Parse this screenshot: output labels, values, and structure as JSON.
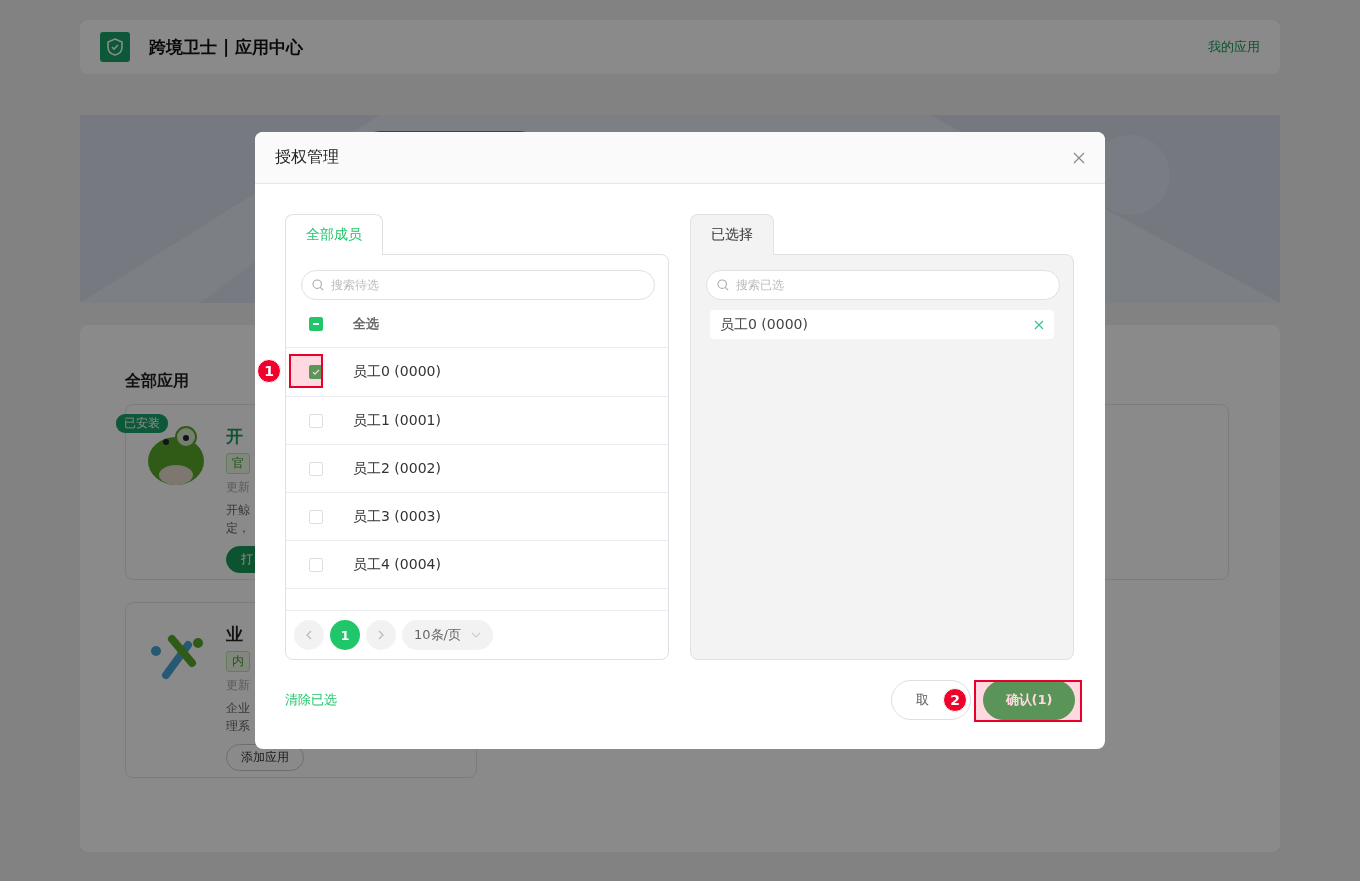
{
  "header": {
    "title": "跨境卫士 | 应用中心",
    "link": "我的应用"
  },
  "section_title": "全部应用",
  "apps": [
    {
      "kind": "installed",
      "badge": "已安装",
      "title": "开",
      "tag": "官",
      "meta": "更新",
      "desc": [
        "开鲸",
        "定，"
      ],
      "button": "打"
    },
    {
      "kind": "available",
      "title": "业",
      "tag": "内",
      "meta": "更新",
      "desc": [
        "企业",
        "理系"
      ],
      "button": "添加应用"
    }
  ],
  "dialog": {
    "title": "授权管理",
    "left_tab": {
      "label": "全部成员",
      "selected": true
    },
    "left_search": {
      "placeholder": "搜索待选"
    },
    "select_all": {
      "label": "全选",
      "indeterminate": true
    },
    "members": [
      {
        "label": "员工0 (0000)",
        "checked": true
      },
      {
        "label": "员工1 (0001)",
        "checked": false
      },
      {
        "label": "员工2 (0002)",
        "checked": false
      },
      {
        "label": "员工3 (0003)",
        "checked": false
      },
      {
        "label": "员工4 (0004)",
        "checked": false
      }
    ],
    "pagination": {
      "pages": [
        {
          "label": "1",
          "selected": true
        }
      ],
      "page_size": "10条/页"
    },
    "right_tab": {
      "label": "已选择",
      "selected": false
    },
    "right_search": {
      "placeholder": "搜索已选"
    },
    "selected_items": [
      "员工0 (0000)"
    ],
    "clear_link": "清除已选",
    "buttons": [
      {
        "kind": "secondary",
        "label": "取"
      },
      {
        "kind": "primary",
        "label": "确认(1)"
      }
    ]
  },
  "annotations": [
    {
      "label": "1"
    },
    {
      "label": "2"
    }
  ]
}
